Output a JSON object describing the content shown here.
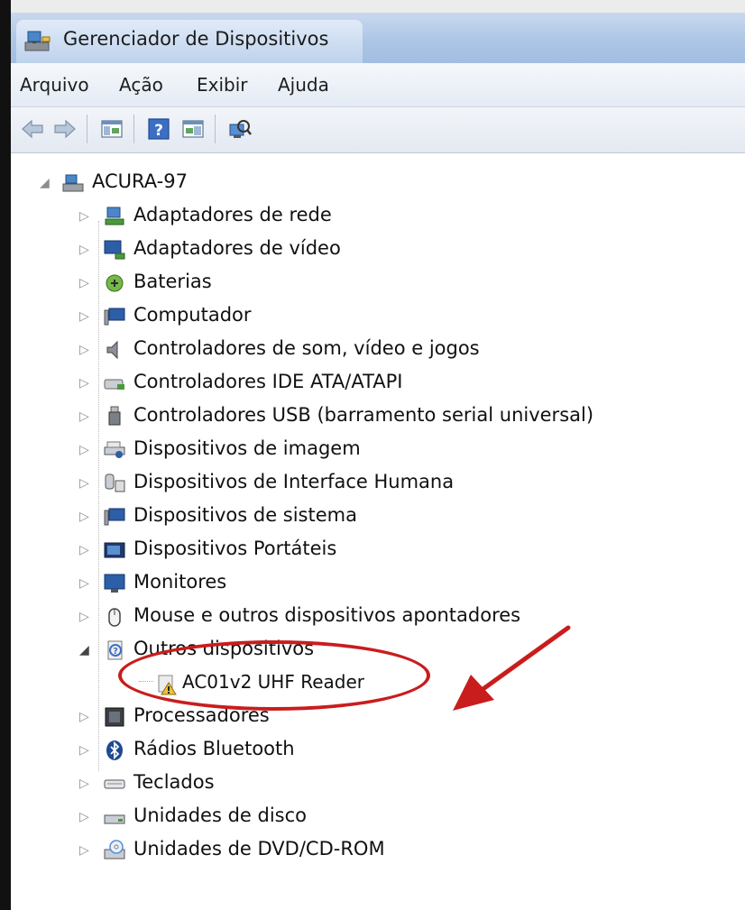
{
  "window": {
    "title": "Gerenciador de Dispositivos"
  },
  "menu": [
    "Arquivo",
    "Ação",
    "Exibir",
    "Ajuda"
  ],
  "toolbar": {
    "buttons": [
      "back-icon",
      "forward-icon",
      "show-hide-tree-icon",
      "help-icon",
      "properties-icon",
      "scan-hardware-icon"
    ]
  },
  "tree": {
    "root": "ACURA-97",
    "categories": [
      "Adaptadores de rede",
      "Adaptadores de vídeo",
      "Baterias",
      "Computador",
      "Controladores de som, vídeo e jogos",
      "Controladores IDE ATA/ATAPI",
      "Controladores USB (barramento serial universal)",
      "Dispositivos de imagem",
      "Dispositivos de Interface Humana",
      "Dispositivos de sistema",
      "Dispositivos Portáteis",
      "Monitores",
      "Mouse e outros dispositivos apontadores",
      "Outros dispositivos",
      "Processadores",
      "Rádios Bluetooth",
      "Teclados",
      "Unidades de disco",
      "Unidades de DVD/CD-ROM"
    ],
    "expanded_category": "Outros dispositivos",
    "child_device": "AC01v2 UHF Reader"
  },
  "colors": {
    "annotation": "#c91d1d",
    "titlebar": "#adc6e6"
  }
}
